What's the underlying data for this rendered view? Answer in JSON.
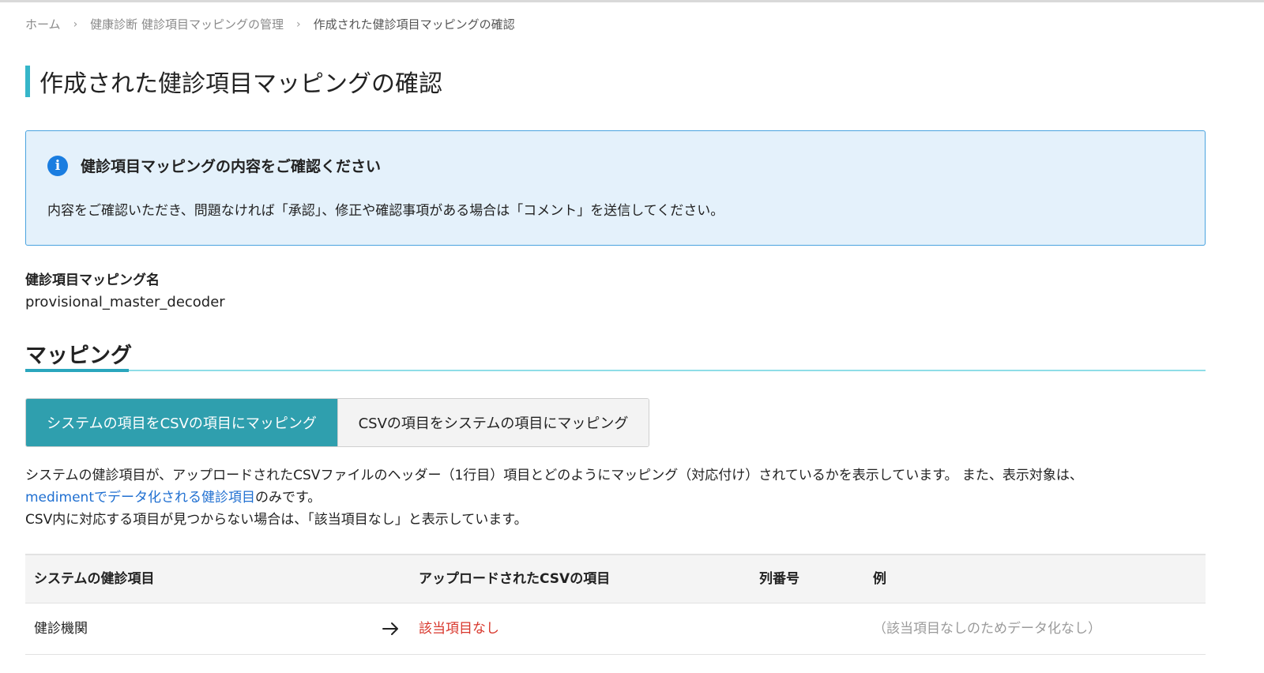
{
  "breadcrumb": {
    "home": "ホーム",
    "manage": "健康診断 健診項目マッピングの管理",
    "current": "作成された健診項目マッピングの確認",
    "separator": "›"
  },
  "page": {
    "title": "作成された健診項目マッピングの確認"
  },
  "info": {
    "icon": "i",
    "title": "健診項目マッピングの内容をご確認ください",
    "text": "内容をご確認いただき、問題なければ「承認」、修正や確認事項がある場合は「コメント」を送信してください。"
  },
  "mapping_name": {
    "label": "健診項目マッピング名",
    "value": "provisional_master_decoder"
  },
  "section": {
    "title": "マッピング"
  },
  "toggle": {
    "system_to_csv": "システムの項目をCSVの項目にマッピング",
    "csv_to_system": "CSVの項目をシステムの項目にマッピング"
  },
  "description": {
    "line1": "システムの健診項目が、アップロードされたCSVファイルのヘッダー（1行目）項目とどのようにマッピング（対応付け）されているかを表示しています。 また、表示対象は、",
    "link": "medimentでデータ化される健診項目",
    "line2_suffix": "のみです。",
    "line3": "CSV内に対応する項目が見つからない場合は、「該当項目なし」と表示しています。"
  },
  "table": {
    "headers": {
      "system_item": "システムの健診項目",
      "csv_item": "アップロードされたCSVの項目",
      "column_no": "列番号",
      "example": "例"
    },
    "rows": [
      {
        "system_item": "健診機関",
        "csv_item": "該当項目なし",
        "column_no": "",
        "example": "（該当項目なしのためデータ化なし）"
      }
    ]
  },
  "colors": {
    "accent": "#2f9fae",
    "title_bar": "#36b6c9",
    "info_bg": "#e4f1fb",
    "info_border": "#4aa3df",
    "link": "#1f6fd1",
    "error": "#d8362b"
  }
}
